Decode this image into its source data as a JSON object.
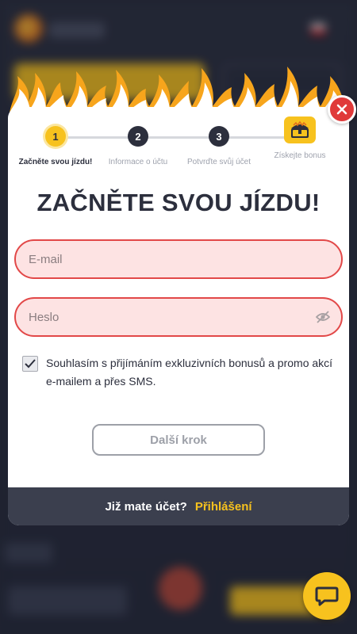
{
  "steps": [
    {
      "number": "1",
      "label": "Začněte svou jízdu!",
      "active": true
    },
    {
      "number": "2",
      "label": "Informace o účtu",
      "active": false
    },
    {
      "number": "3",
      "label": "Potvrďte svůj účet",
      "active": false
    },
    {
      "icon": "treasure-chest-icon",
      "label": "Získejte bonus",
      "active": false
    }
  ],
  "title": "ZAČNĚTE SVOU JÍZDU!",
  "email": {
    "placeholder": "E-mail",
    "value": ""
  },
  "password": {
    "placeholder": "Heslo",
    "value": ""
  },
  "consent": {
    "checked": true,
    "text": "Souhlasím s přijímáním exkluzivních bonusů a promo akcí e-mailem a přes SMS."
  },
  "next_button": "Další krok",
  "footer": {
    "question": "Již mate účet?",
    "login": "Přihlášení"
  },
  "colors": {
    "accent": "#f7c21e",
    "error": "#e24848",
    "dark": "#2c2f3d"
  },
  "icons": {
    "close": "close-icon",
    "eye": "eye-slash-icon",
    "chat": "chat-bubble-icon"
  }
}
